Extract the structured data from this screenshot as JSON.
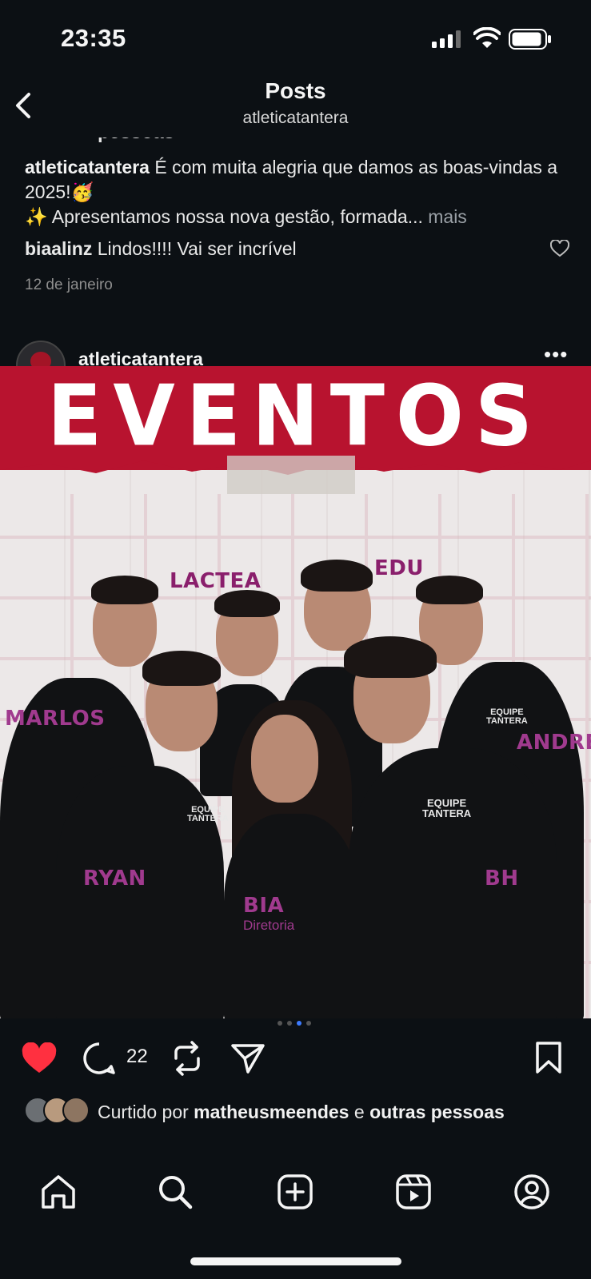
{
  "status_bar": {
    "time": "23:35"
  },
  "header": {
    "title": "Posts",
    "subtitle": "atleticatantera"
  },
  "previous_post": {
    "clipped_text": "pessoas",
    "caption_user": "atleticatantera",
    "caption_line1": "É com muita alegria que damos as boas-vindas a 2025!🥳",
    "caption_line2": "✨ Apresentamos nossa nova gestão, formada...",
    "more_label": "mais",
    "comment_user": "biaalinz",
    "comment_text": "Lindos!!!! Vai ser incrível",
    "date": "12 de janeiro"
  },
  "post": {
    "username": "atleticatantera",
    "image": {
      "headline": "EVENTOS",
      "names": [
        "LACTEA",
        "EDU",
        "MARLOS",
        "ANDRÉ",
        "RYAN",
        "BIA",
        "BH"
      ],
      "role": "Diretoria",
      "shirt_logo_top": "EQUIPE",
      "shirt_logo_bottom": "TANTERA"
    },
    "comment_count": "22",
    "liked": true,
    "likes_prefix": "Curtido por",
    "likes_user": "matheusmeendes",
    "likes_connector": "e",
    "likes_suffix": "outras pessoas"
  },
  "icons": {
    "back": "chevron-left-icon",
    "like": "heart-icon",
    "comment": "comment-icon",
    "repost": "repost-icon",
    "share": "send-icon",
    "save": "bookmark-icon",
    "nav": [
      "home-icon",
      "search-icon",
      "add-post-icon",
      "reels-icon",
      "profile-icon"
    ]
  },
  "colors": {
    "background": "#0c1014",
    "like_red": "#ff3040",
    "banner_red": "#b8132f",
    "name_purple": "#8a1f6c"
  }
}
